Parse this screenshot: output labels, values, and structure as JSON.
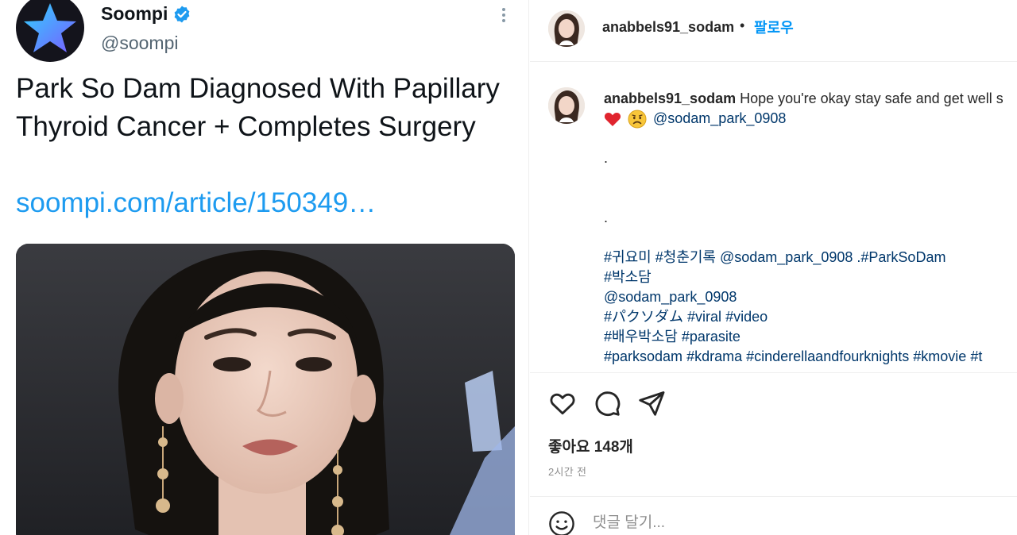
{
  "tweet": {
    "author_name": "Soompi",
    "author_handle": "@soompi",
    "text": "Park So Dam Diagnosed With Papillary Thyroid Cancer + Completes Surgery",
    "link": "soompi.com/article/150349…"
  },
  "instagram": {
    "header": {
      "username": "anabbels91_sodam",
      "separator": "•",
      "follow_label": "팔로우"
    },
    "caption": {
      "username": "anabbels91_sodam",
      "text": "Hope you're okay stay safe and get well s",
      "mention_1": "@sodam_park_0908",
      "dot_1": ".",
      "dot_2": ".",
      "line_1_tag_a": "#귀요미",
      "line_1_tag_b": "#청춘기록",
      "line_1_mention": "@sodam_park_0908",
      "line_1_tag_c": ".#ParkSoDam",
      "line_2": "#박소담",
      "line_3": "@sodam_park_0908",
      "line_4_tag_a": "#パクソダム",
      "line_4_tag_b": "#viral",
      "line_4_tag_c": "#video",
      "line_5_tag_a": "#배우박소담",
      "line_5_tag_b": "#parasite",
      "line_6_tag_a": "#parksodam",
      "line_6_tag_b": "#kdrama",
      "line_6_tag_c": "#cinderellaandfourknights",
      "line_6_tag_d": "#kmovie",
      "line_6_tag_e": "#t"
    },
    "likes": "좋아요 148개",
    "time_ago": "2시간 전",
    "comment_placeholder": "댓글 달기..."
  },
  "icons": {
    "verified": "verified-badge-icon",
    "more": "more-vertical-icon",
    "like": "heart-icon",
    "comment": "comment-bubble-icon",
    "share": "paper-plane-icon",
    "emoji": "smiley-icon"
  },
  "colors": {
    "twitter_blue": "#1d9bf0",
    "instagram_blue": "#0095f6",
    "instagram_link": "#00376b",
    "muted_text": "#8e8e8e"
  }
}
